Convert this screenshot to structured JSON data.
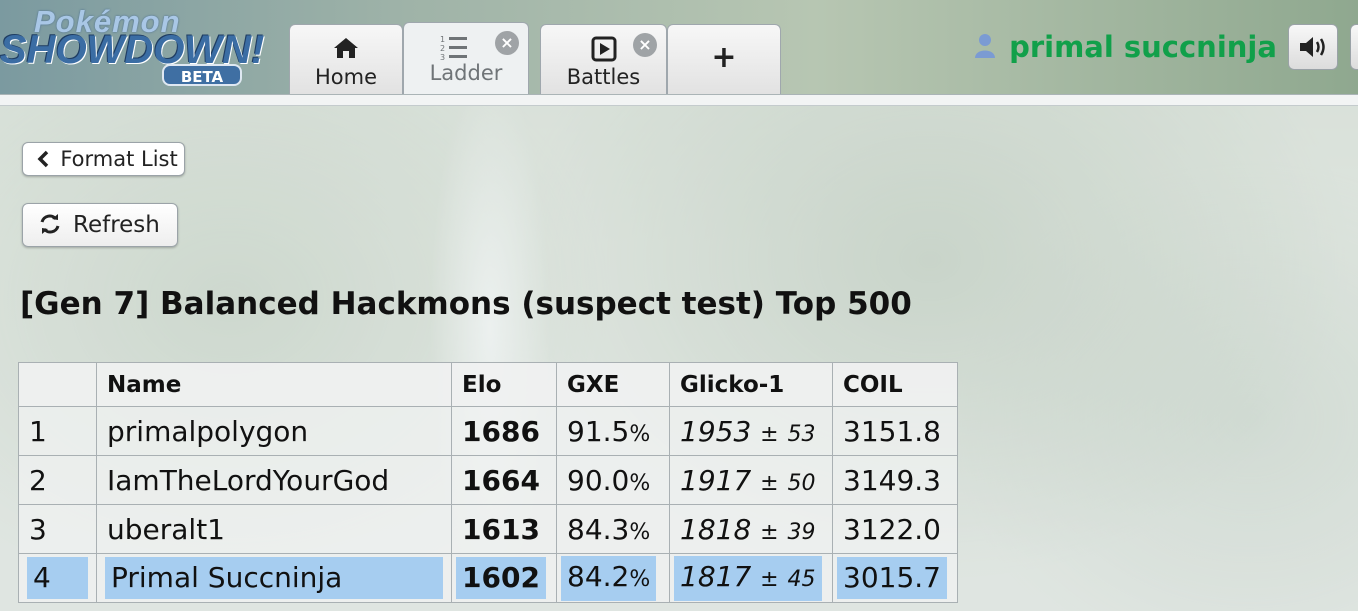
{
  "logo": {
    "line1": "Pokémon",
    "line2": "SHOWDOWN!",
    "badge": "BETA"
  },
  "tabs": [
    {
      "label": "Home",
      "icon": "home-icon",
      "active": false,
      "closable": false
    },
    {
      "label": "Ladder",
      "icon": "list-ol-icon",
      "active": true,
      "closable": true
    },
    {
      "label": "Battles",
      "icon": "play-square-icon",
      "active": false,
      "closable": true
    },
    {
      "label": "",
      "icon": "plus-icon",
      "active": false,
      "closable": false
    }
  ],
  "user": {
    "name": "primal succninja",
    "icon": "user-icon",
    "color": "#11a04a"
  },
  "sound_button": {
    "icon": "volume-up-icon"
  },
  "buttons": {
    "format_list": "Format List",
    "refresh": "Refresh"
  },
  "ladder": {
    "title": "[Gen 7] Balanced Hackmons (suspect test) Top 500",
    "columns": [
      "",
      "Name",
      "Elo",
      "GXE",
      "Glicko-1",
      "COIL"
    ],
    "rows": [
      {
        "rank": "1",
        "name": "primalpolygon",
        "elo": "1686",
        "gxe": "91.5",
        "glicko": "1953",
        "dev": "53",
        "coil": "3151.8"
      },
      {
        "rank": "2",
        "name": "IamTheLordYourGod",
        "elo": "1664",
        "gxe": "90.0",
        "glicko": "1917",
        "dev": "50",
        "coil": "3149.3"
      },
      {
        "rank": "3",
        "name": "uberalt1",
        "elo": "1613",
        "gxe": "84.3",
        "glicko": "1818",
        "dev": "39",
        "coil": "3122.0"
      },
      {
        "rank": "4",
        "name": "Primal Succninja",
        "elo": "1602",
        "gxe": "84.2",
        "glicko": "1817",
        "dev": "45",
        "coil": "3015.7",
        "highlighted": true
      }
    ],
    "pct_sign": "%",
    "pm_sign": "±",
    "highlight_color": "#a6cdf0"
  }
}
